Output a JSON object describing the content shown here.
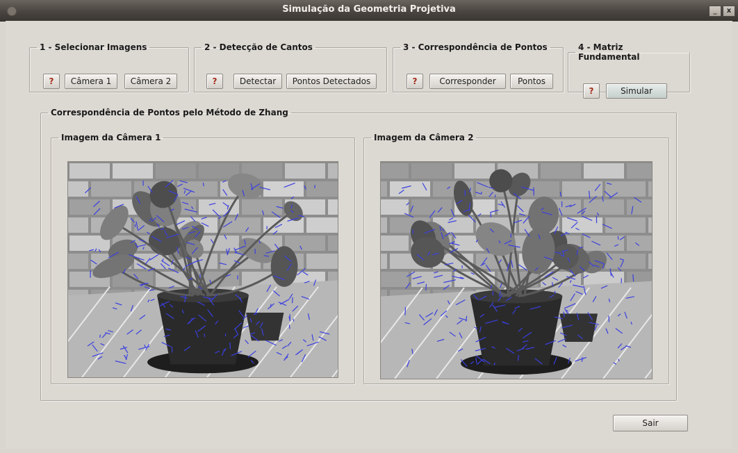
{
  "window": {
    "title": "Simulação da Geometria Projetiva",
    "minimize_label": "_",
    "close_label": "x"
  },
  "steps": [
    {
      "legend": "1 - Selecionar Imagens",
      "help": "?",
      "buttons": [
        "Câmera 1",
        "Câmera 2"
      ]
    },
    {
      "legend": "2 - Detecção de Cantos",
      "help": "?",
      "buttons": [
        "Detectar",
        "Pontos Detectados"
      ]
    },
    {
      "legend": "3 - Correspondência de Pontos",
      "help": "?",
      "buttons": [
        "Corresponder",
        "Pontos"
      ]
    },
    {
      "legend": "4 - Matriz Fundamental",
      "help": "?",
      "buttons": [
        "Simular"
      ]
    }
  ],
  "main_panel": {
    "legend": "Correspondência de Pontos pelo Método de Zhang",
    "camera1": {
      "legend": "Imagem da Câmera 1"
    },
    "camera2": {
      "legend": "Imagem da Câmera 2"
    }
  },
  "footer": {
    "exit_label": "Sair"
  },
  "colors": {
    "vectors": "#3a3fe0",
    "accent_help": "#a32c1a"
  }
}
